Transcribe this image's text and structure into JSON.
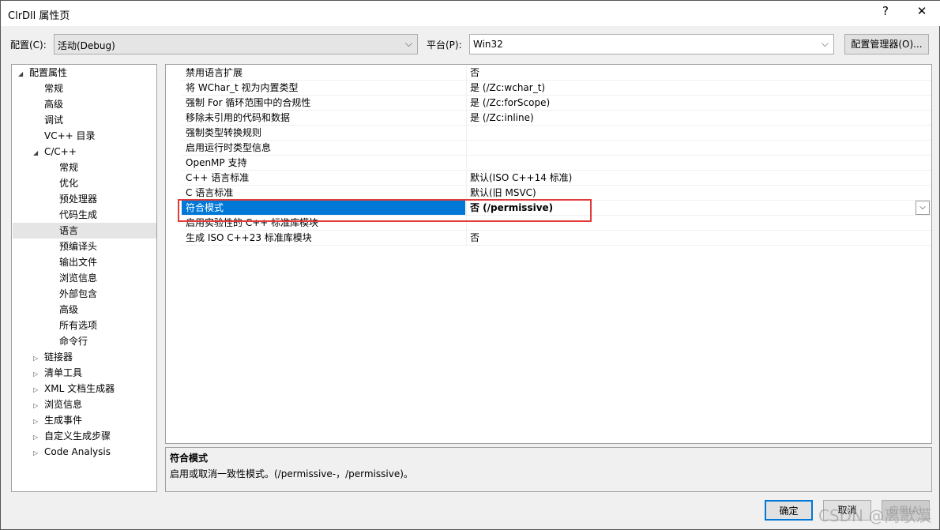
{
  "window": {
    "title": "ClrDll 属性页",
    "help": "?",
    "close": "✕"
  },
  "config": {
    "label": "配置(C):",
    "value": "活动(Debug)",
    "platform_label": "平台(P):",
    "platform_value": "Win32",
    "manager_button": "配置管理器(O)..."
  },
  "tree": [
    {
      "label": "配置属性",
      "level": 0,
      "arrow": "expanded"
    },
    {
      "label": "常规",
      "level": 1
    },
    {
      "label": "高级",
      "level": 1
    },
    {
      "label": "调试",
      "level": 1
    },
    {
      "label": "VC++ 目录",
      "level": 1
    },
    {
      "label": "C/C++",
      "level": 1,
      "arrow": "expanded"
    },
    {
      "label": "常规",
      "level": 2
    },
    {
      "label": "优化",
      "level": 2
    },
    {
      "label": "预处理器",
      "level": 2
    },
    {
      "label": "代码生成",
      "level": 2
    },
    {
      "label": "语言",
      "level": 2,
      "selected": true
    },
    {
      "label": "预编译头",
      "level": 2
    },
    {
      "label": "输出文件",
      "level": 2
    },
    {
      "label": "浏览信息",
      "level": 2
    },
    {
      "label": "外部包含",
      "level": 2
    },
    {
      "label": "高级",
      "level": 2
    },
    {
      "label": "所有选项",
      "level": 2
    },
    {
      "label": "命令行",
      "level": 2
    },
    {
      "label": "链接器",
      "level": 1,
      "arrow": "collapsed"
    },
    {
      "label": "清单工具",
      "level": 1,
      "arrow": "collapsed"
    },
    {
      "label": "XML 文档生成器",
      "level": 1,
      "arrow": "collapsed"
    },
    {
      "label": "浏览信息",
      "level": 1,
      "arrow": "collapsed"
    },
    {
      "label": "生成事件",
      "level": 1,
      "arrow": "collapsed"
    },
    {
      "label": "自定义生成步骤",
      "level": 1,
      "arrow": "collapsed"
    },
    {
      "label": "Code Analysis",
      "level": 1,
      "arrow": "collapsed"
    }
  ],
  "properties": [
    {
      "name": "禁用语言扩展",
      "value": "否"
    },
    {
      "name": "将 WChar_t 视为内置类型",
      "value": "是 (/Zc:wchar_t)"
    },
    {
      "name": "强制 For 循环范围中的合规性",
      "value": "是 (/Zc:forScope)"
    },
    {
      "name": "移除未引用的代码和数据",
      "value": "是 (/Zc:inline)"
    },
    {
      "name": "强制类型转换规则",
      "value": ""
    },
    {
      "name": "启用运行时类型信息",
      "value": ""
    },
    {
      "name": "OpenMP 支持",
      "value": ""
    },
    {
      "name": "C++ 语言标准",
      "value": "默认(ISO C++14 标准)"
    },
    {
      "name": "C 语言标准",
      "value": "默认(旧 MSVC)"
    },
    {
      "name": "符合模式",
      "value": "否 (/permissive)",
      "selected": true
    },
    {
      "name": "启用实验性的 C++ 标准库模块",
      "value": ""
    },
    {
      "name": "生成 ISO C++23 标准库模块",
      "value": "否"
    }
  ],
  "description": {
    "title": "符合模式",
    "text": "启用或取消一致性模式。(/permissive-，/permissive)。"
  },
  "buttons": {
    "ok": "确定",
    "cancel": "取消",
    "apply": "应用(A)"
  },
  "watermark": "CSDN @离歌漠"
}
